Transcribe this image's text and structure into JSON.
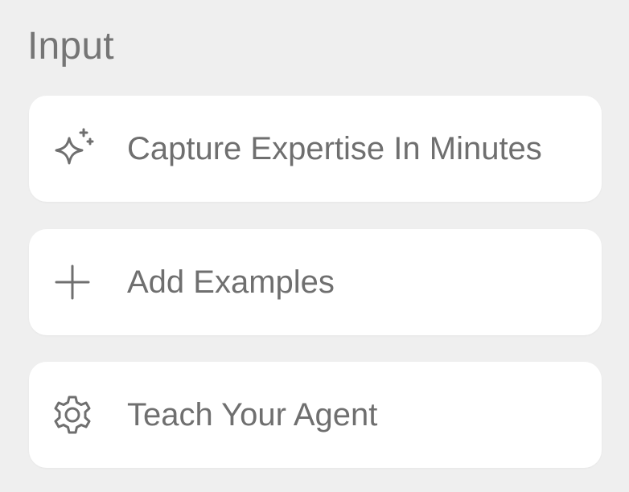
{
  "section": {
    "title": "Input"
  },
  "items": [
    {
      "label": "Capture Expertise In Minutes",
      "icon": "sparkle-icon"
    },
    {
      "label": "Add Examples",
      "icon": "plus-icon"
    },
    {
      "label": "Teach Your Agent",
      "icon": "gear-icon"
    }
  ],
  "colors": {
    "background": "#efefef",
    "card": "#ffffff",
    "text": "#6f6f6f",
    "title": "#757575",
    "icon": "#6f6f6f"
  }
}
